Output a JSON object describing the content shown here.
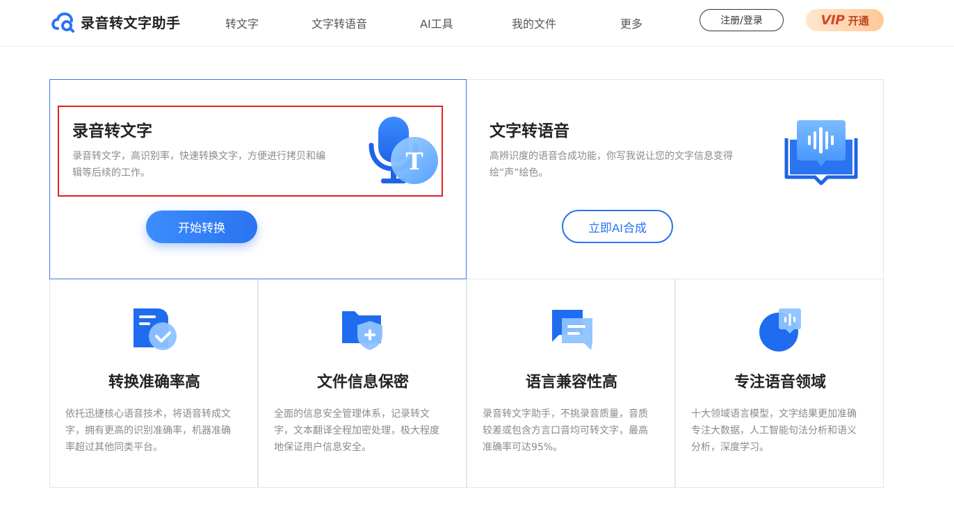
{
  "header": {
    "brand": "录音转文字助手",
    "nav": [
      "转文字",
      "文字转语音",
      "AI工具",
      "我的文件",
      "更多"
    ],
    "login_label": "注册/登录",
    "vip_badge": "VIP",
    "vip_label": "开通"
  },
  "features": {
    "speech_to_text": {
      "title": "录音转文字",
      "desc": "录音转文字，高识别率，快速转换文字，方便进行拷贝和编辑等后续的工作。",
      "button": "开始转换",
      "icon_glyph": "T"
    },
    "text_to_speech": {
      "title": "文字转语音",
      "desc": "高辨识度的语音合成功能，你写我说让您的文字信息变得绘“声”绘色。",
      "button": "立即AI合成"
    }
  },
  "advantages": [
    {
      "title": "转换准确率高",
      "desc": "依托迅捷核心语音技术，将语音转成文字，拥有更高的识别准确率，机器准确率超过其他同类平台。"
    },
    {
      "title": "文件信息保密",
      "desc": "全面的信息安全管理体系，记录转文字，文本翻译全程加密处理，极大程度地保证用户信息安全。"
    },
    {
      "title": "语言兼容性高",
      "desc": "录音转文字助手，不挑录音质量，音质较差或包含方言口音均可转文字，最高准确率可达95%。"
    },
    {
      "title": "专注语音领域",
      "desc": "十大领域语言模型，文字结果更加准确专注大数据，人工智能句法分析和语义分析，深度学习。"
    }
  ],
  "colors": {
    "accent": "#2b74f0",
    "highlight": "#e02020",
    "vip_text": "#b8441f"
  }
}
